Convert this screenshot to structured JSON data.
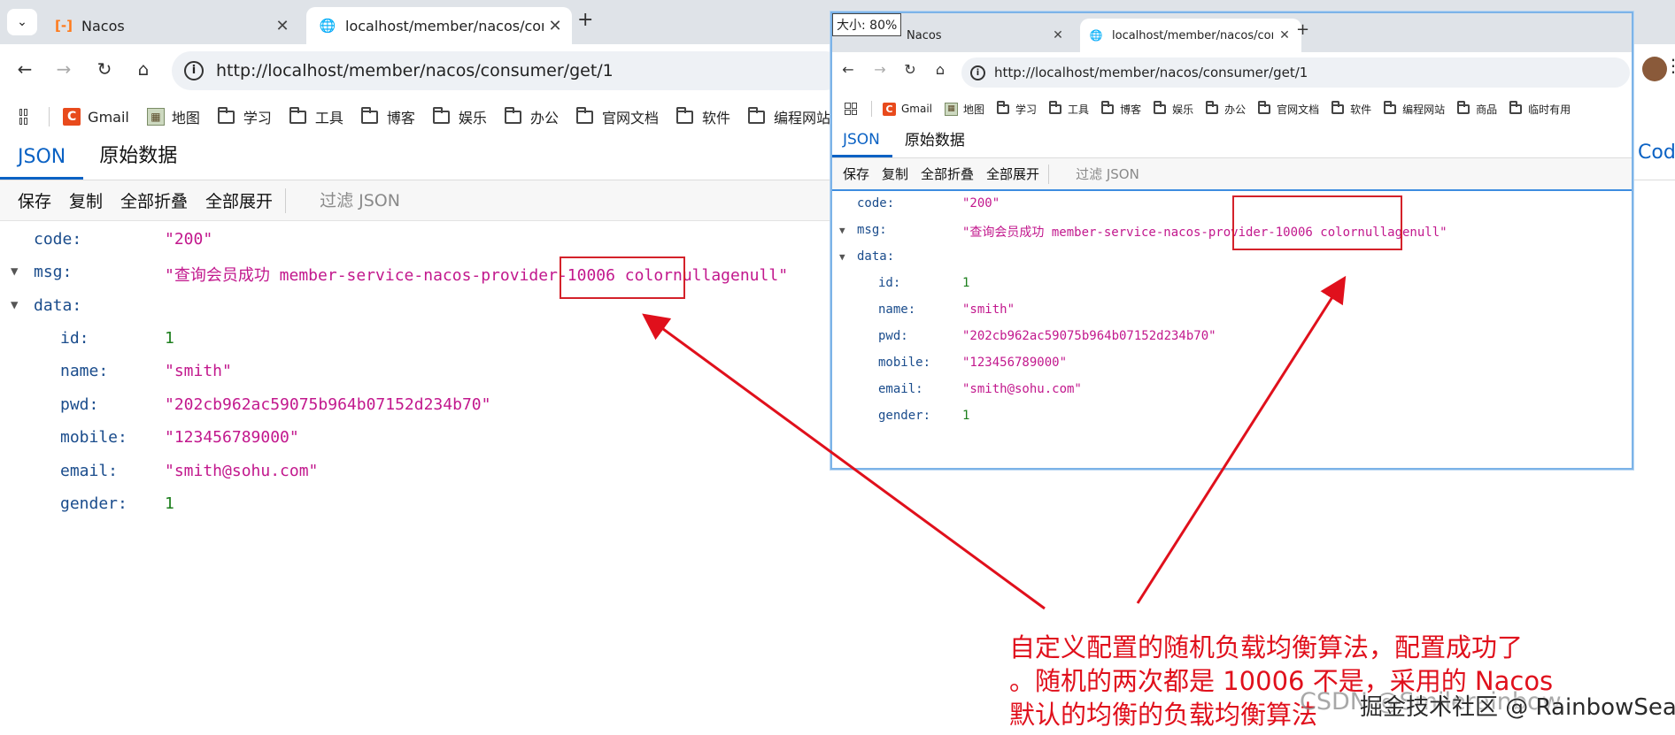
{
  "main_browser": {
    "tabs": [
      {
        "title": "Nacos",
        "close": "✕"
      },
      {
        "title": "localhost/member/nacos/cor",
        "close": "✕"
      }
    ],
    "new_tab": "+",
    "url": "http://localhost/member/nacos/consumer/get/1",
    "bookmarks": [
      "Gmail",
      "地图",
      "学习",
      "工具",
      "博客",
      "娱乐",
      "办公",
      "官网文档",
      "软件",
      "编程网站"
    ],
    "viewer_tabs": [
      "JSON",
      "原始数据"
    ],
    "actions": [
      "保存",
      "复制",
      "全部折叠",
      "全部展开"
    ],
    "filter_label": "过滤 JSON",
    "edge_text": "Cod"
  },
  "popup_browser": {
    "zoom_label": "大小: 80%",
    "tabs": [
      {
        "title": "Nacos",
        "close": "✕"
      },
      {
        "title": "localhost/member/nacos/cor",
        "close": "✕"
      }
    ],
    "new_tab": "+",
    "url": "http://localhost/member/nacos/consumer/get/1",
    "bookmarks": [
      "Gmail",
      "地图",
      "学习",
      "工具",
      "博客",
      "娱乐",
      "办公",
      "官网文档",
      "软件",
      "编程网站",
      "商品",
      "临时有用"
    ],
    "viewer_tabs": [
      "JSON",
      "原始数据"
    ],
    "actions": [
      "保存",
      "复制",
      "全部折叠",
      "全部展开"
    ],
    "filter_label": "过滤 JSON"
  },
  "json_main": {
    "code_key": "code:",
    "code_val": "\"200\"",
    "msg_key": "msg:",
    "msg_val": "\"查询会员成功 member-service-nacos-provider-10006  colornullagenull\"",
    "data_key": "data:",
    "fields": [
      {
        "key": "id:",
        "val": "1",
        "kind": "num"
      },
      {
        "key": "name:",
        "val": "\"smith\"",
        "kind": "str"
      },
      {
        "key": "pwd:",
        "val": "\"202cb962ac59075b964b07152d234b70\"",
        "kind": "str"
      },
      {
        "key": "mobile:",
        "val": "\"123456789000\"",
        "kind": "str"
      },
      {
        "key": "email:",
        "val": "\"smith@sohu.com\"",
        "kind": "str"
      },
      {
        "key": "gender:",
        "val": "1",
        "kind": "num"
      }
    ]
  },
  "json_popup": {
    "code_key": "code:",
    "code_val": "\"200\"",
    "msg_key": "msg:",
    "msg_val": "\"查询会员成功 member-service-nacos-provider-10006  colornullagenull\"",
    "data_key": "data:",
    "fields": [
      {
        "key": "id:",
        "val": "1",
        "kind": "num"
      },
      {
        "key": "name:",
        "val": "\"smith\"",
        "kind": "str"
      },
      {
        "key": "pwd:",
        "val": "\"202cb962ac59075b964b07152d234b70\"",
        "kind": "str"
      },
      {
        "key": "mobile:",
        "val": "\"123456789000\"",
        "kind": "str"
      },
      {
        "key": "email:",
        "val": "\"smith@sohu.com\"",
        "kind": "str"
      },
      {
        "key": "gender:",
        "val": "1",
        "kind": "num"
      }
    ]
  },
  "annotation": {
    "line1": "自定义配置的随机负载均衡算法，配置成功了",
    "line2": "。随机的两次都是 10006 不是，采用的 Nacos",
    "line3": "默认的均衡的负载均衡算法"
  },
  "watermark": {
    "csdn": "CSDN @Smilerainbow",
    "juejin": "掘金技术社区 @ RainbowSea"
  },
  "colors": {
    "accent": "#0b62c4",
    "annotation_red": "#e0101c",
    "json_key": "#1a4c8c",
    "json_string": "#c2188d",
    "json_number": "#1d7f1d"
  }
}
